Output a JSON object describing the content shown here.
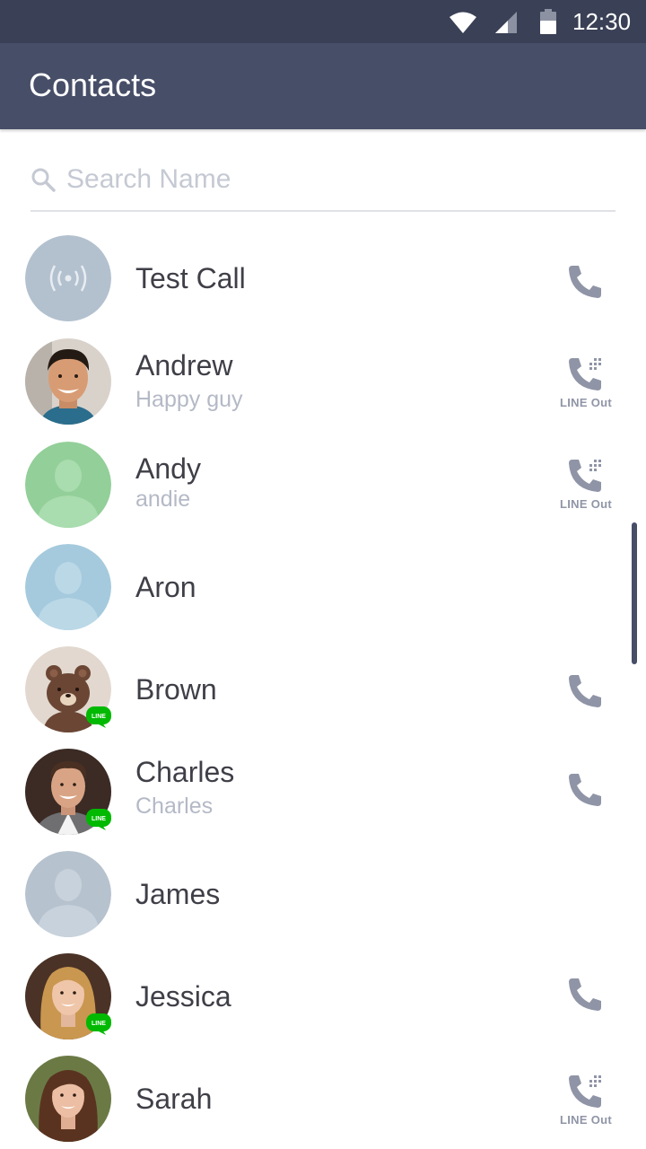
{
  "status_bar": {
    "time": "12:30",
    "icons": [
      "wifi-icon",
      "signal-icon",
      "battery-icon"
    ]
  },
  "app_bar": {
    "title": "Contacts"
  },
  "search": {
    "placeholder": "Search Name",
    "icon": "search-icon"
  },
  "colors": {
    "status_bar": "#3a4056",
    "app_bar": "#474e68",
    "icon_gray": "#8f94a6",
    "line_green": "#00b900"
  },
  "contacts": [
    {
      "name": "Test Call",
      "status": "",
      "avatar": "broadcast-avatar",
      "action": "call-icon"
    },
    {
      "name": "Andrew",
      "status": "Happy guy",
      "avatar": "photo-avatar",
      "action": "line-out-icon"
    },
    {
      "name": "Andy",
      "status": "andie",
      "avatar": "green-silhouette-avatar",
      "action": "line-out-icon"
    },
    {
      "name": "Aron",
      "status": "",
      "avatar": "blue-silhouette-avatar",
      "action": ""
    },
    {
      "name": "Brown",
      "status": "",
      "avatar": "bear-avatar",
      "badge": "LINE",
      "action": "call-icon"
    },
    {
      "name": "Charles",
      "status": "Charles",
      "avatar": "photo-avatar",
      "badge": "LINE",
      "action": "call-icon"
    },
    {
      "name": "James",
      "status": "",
      "avatar": "gray-silhouette-avatar",
      "action": ""
    },
    {
      "name": "Jessica",
      "status": "",
      "avatar": "photo-avatar",
      "badge": "LINE",
      "action": "call-icon"
    },
    {
      "name": "Sarah",
      "status": "",
      "avatar": "photo-avatar",
      "action": "line-out-icon"
    }
  ],
  "line_out_label": "LINE Out"
}
